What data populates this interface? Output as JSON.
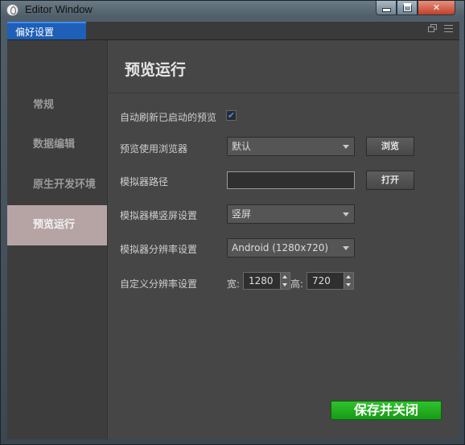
{
  "window": {
    "title": "Editor Window",
    "icon": "app-logo-icon"
  },
  "tabbar": {
    "tab_label": "偏好设置",
    "icons": [
      "restore-window-icon",
      "menu-icon"
    ]
  },
  "sidebar": {
    "items": [
      {
        "label": "常规",
        "active": false
      },
      {
        "label": "数据编辑",
        "active": false
      },
      {
        "label": "原生开发环境",
        "active": false
      },
      {
        "label": "预览运行",
        "active": true
      }
    ]
  },
  "main": {
    "title": "预览运行",
    "auto_refresh": {
      "label": "自动刷新已启动的预览",
      "checked": true,
      "check_glyph": "✔"
    },
    "browser": {
      "label": "预览使用浏览器",
      "value": "默认",
      "button": "浏览"
    },
    "simulator_path": {
      "label": "模拟器路径",
      "value": "",
      "button": "打开"
    },
    "orientation": {
      "label": "模拟器横竖屏设置",
      "value": "竖屏"
    },
    "resolution": {
      "label": "模拟器分辨率设置",
      "value": "Android (1280x720)"
    },
    "custom_resolution": {
      "label": "自定义分辨率设置",
      "width_label": "宽:",
      "width_value": "1280",
      "height_label": "高:",
      "height_value": "720"
    },
    "save_button": "保存并关闭"
  },
  "colors": {
    "accent_tab": "#1e5fb7",
    "active_sidebar": "#b6a4a5",
    "save_green": "#22b21f",
    "checkbox_blue": "#3d8fff"
  }
}
